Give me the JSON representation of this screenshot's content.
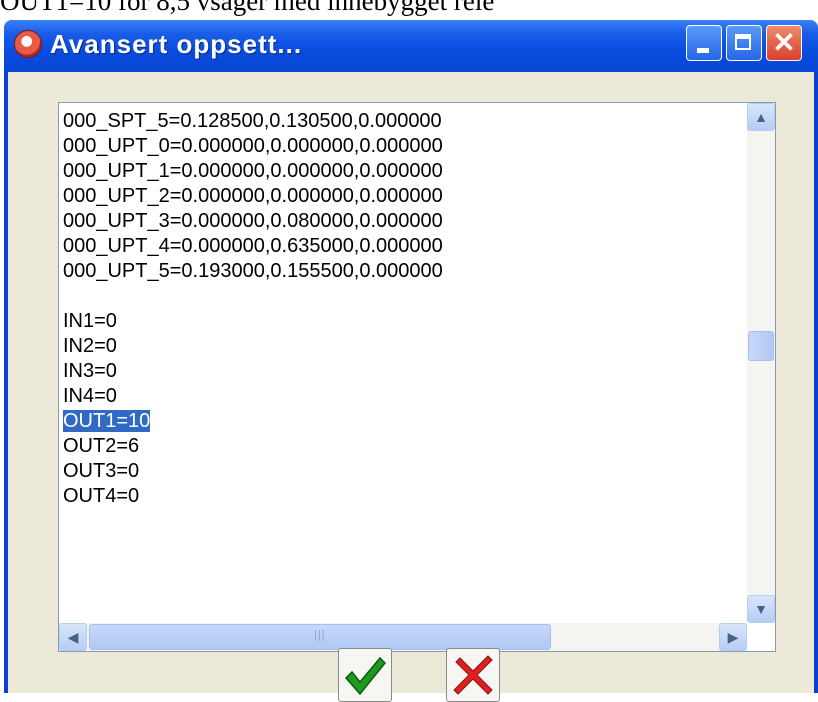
{
  "page_caption": "OUT1=10 for 8,5 vsager med innebygget rele",
  "window": {
    "title": "Avansert oppsett...",
    "minimize_label": "",
    "maximize_label": "",
    "close_label": "✕"
  },
  "textarea": {
    "lines": [
      "000_SPT_5=0.128500,0.130500,0.000000",
      "000_UPT_0=0.000000,0.000000,0.000000",
      "000_UPT_1=0.000000,0.000000,0.000000",
      "000_UPT_2=0.000000,0.000000,0.000000",
      "000_UPT_3=0.000000,0.080000,0.000000",
      "000_UPT_4=0.000000,0.635000,0.000000",
      "000_UPT_5=0.193000,0.155500,0.000000",
      "",
      "IN1=0",
      "IN2=0",
      "IN3=0",
      "IN4=0",
      "OUT1=10",
      "OUT2=6",
      "OUT3=0",
      "OUT4=0"
    ],
    "selected_line": "OUT1=10"
  },
  "icons": {
    "scroll_up": "arrow-up-icon",
    "scroll_down": "arrow-down-icon",
    "scroll_left": "arrow-left-icon",
    "scroll_right": "arrow-right-icon",
    "ok": "green-checkmark-icon",
    "cancel": "red-x-icon"
  },
  "colors": {
    "titlebar": "#0a4be0",
    "selection": "#316ac5",
    "ok": "#1f9a1f",
    "cancel": "#e02020"
  }
}
